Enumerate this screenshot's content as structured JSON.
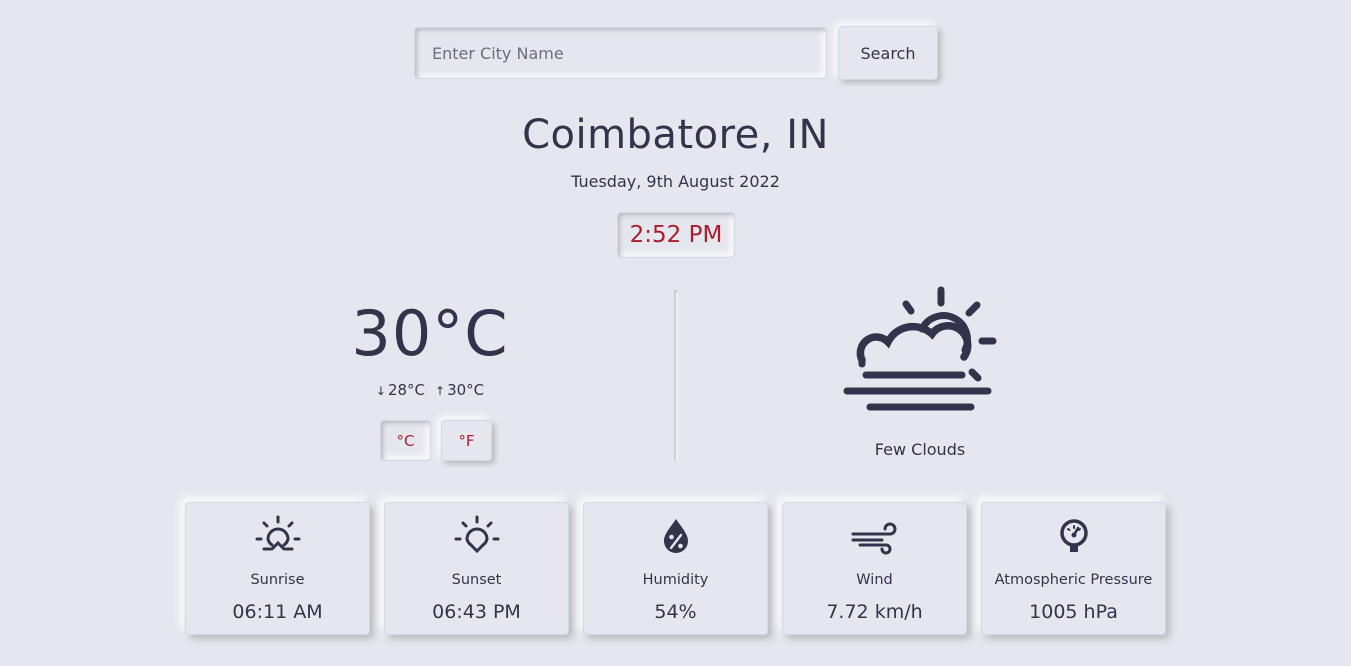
{
  "search": {
    "placeholder": "Enter City Name",
    "button_label": "Search"
  },
  "location": {
    "city": "Coimbatore, IN",
    "date": "Tuesday, 9th August 2022",
    "time": "2:52 PM"
  },
  "temperature": {
    "current": "30°C",
    "min": "28°C",
    "max": "30°C",
    "min_arrow": "↓",
    "max_arrow": "↑",
    "unit_celsius": "°C",
    "unit_fahrenheit": "°F",
    "active_unit": "celsius"
  },
  "condition": {
    "icon": "few-clouds-icon",
    "description": "Few Clouds"
  },
  "stats": [
    {
      "icon": "sunrise-icon",
      "label": "Sunrise",
      "value": "06:11 AM"
    },
    {
      "icon": "sunset-icon",
      "label": "Sunset",
      "value": "06:43 PM"
    },
    {
      "icon": "humidity-icon",
      "label": "Humidity",
      "value": "54%"
    },
    {
      "icon": "wind-icon",
      "label": "Wind",
      "value": "7.72 km/h"
    },
    {
      "icon": "pressure-gauge-icon",
      "label": "Atmospheric Pressure",
      "value": "1005 hPa"
    }
  ],
  "colors": {
    "background": "#e6e7ee",
    "text": "#31344b",
    "accent": "#a91e2c"
  }
}
